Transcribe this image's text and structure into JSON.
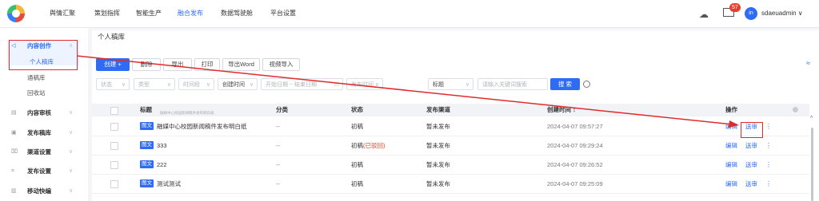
{
  "topnav": [
    "舆情汇聚",
    "策划指挥",
    "智能生产",
    "融合发布",
    "数据驾驶舱",
    "平台设置"
  ],
  "header": {
    "notification_count": "57",
    "avatar_text": "in",
    "username": "sdaeuadmin ∨"
  },
  "sidebar": {
    "items": [
      {
        "label": "内容创作",
        "icon": "◁"
      },
      {
        "label": "内容审核",
        "icon": "▤"
      },
      {
        "label": "发布稿库",
        "icon": "▣"
      },
      {
        "label": "渠道设置",
        "icon": "⌧"
      },
      {
        "label": "发布设置",
        "icon": "⌗"
      },
      {
        "label": "移动快编",
        "icon": "▥"
      }
    ],
    "subitems": [
      "个人稿库",
      "通稿库",
      "回收站"
    ]
  },
  "page": {
    "title": "个人稿库"
  },
  "toolbar": {
    "create": "创建 +",
    "delete": "删除",
    "export": "导出",
    "print": "打印",
    "export_word": "导出Word",
    "video_import": "视频导入"
  },
  "filters": {
    "status": "状态",
    "type": "类型",
    "time_period": "时间段",
    "create_time": "创建时间",
    "start_date": "开始日期",
    "arrow": "~",
    "end_date": "结束日期",
    "publish_time": "发布时间",
    "tag": "标题",
    "keyword_placeholder": "请输入关键词搜索",
    "search": "搜 索"
  },
  "table": {
    "columns": {
      "title": "标题",
      "category": "分类",
      "status": "状态",
      "channel": "发布渠道",
      "created": "创建时间 ↕",
      "ops": "操作"
    },
    "title_hint": "融媒中心校园新闻稿件发布明白纸",
    "rows": [
      {
        "tag": "图文",
        "title": "融媒中心校园新闻稿件发布明白纸",
        "category": "--",
        "status": "初稿",
        "status_note": "",
        "channel": "暂未发布",
        "created": "2024-04-07 09:57:27",
        "edit": "编辑",
        "submit": "送审"
      },
      {
        "tag": "图文",
        "title": "333",
        "category": "--",
        "status": "初稿",
        "status_note": "(已驳回)",
        "channel": "暂未发布",
        "created": "2024-04-07 09:29:24",
        "edit": "编辑",
        "submit": "送审"
      },
      {
        "tag": "图文",
        "title": "222",
        "category": "--",
        "status": "初稿",
        "status_note": "",
        "channel": "暂未发布",
        "created": "2024-04-07 09:26:52",
        "edit": "编辑",
        "submit": "送审"
      },
      {
        "tag": "图文",
        "title": "测试测试",
        "category": "--",
        "status": "初稿",
        "status_note": "",
        "channel": "暂未发布",
        "created": "2024-04-07 09:25:09",
        "edit": "编辑",
        "submit": "送审"
      }
    ]
  },
  "colors": {
    "accent": "#2e6cf6",
    "annotation": "#e02b2b",
    "warning": "#e5402f"
  }
}
